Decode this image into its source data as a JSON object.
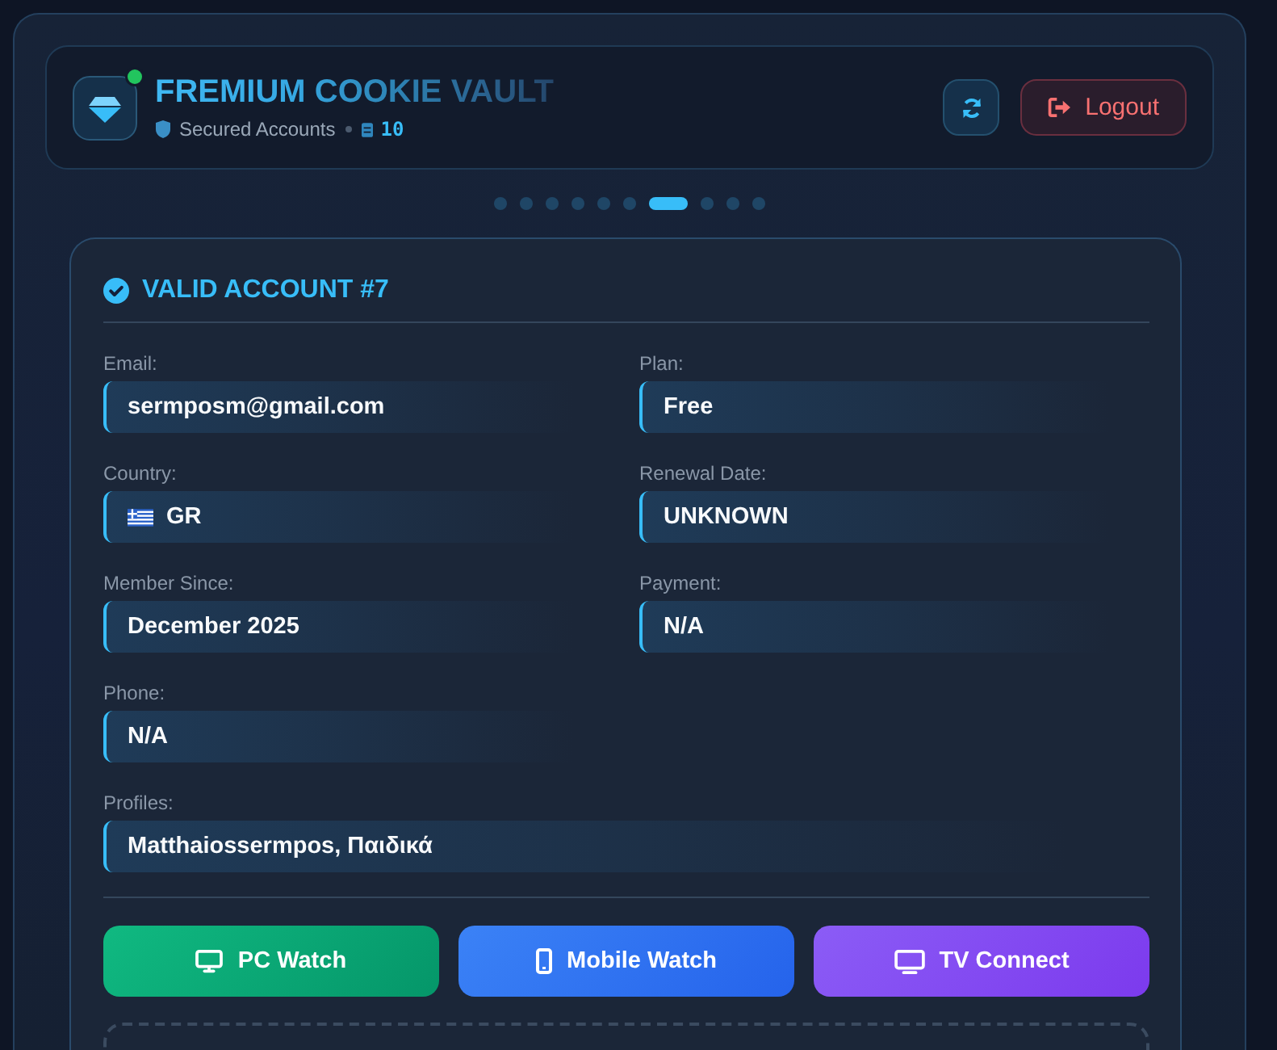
{
  "header": {
    "title": "FREMIUM COOKIE VAULT",
    "online": true,
    "subtitle": "Secured Accounts",
    "count": "10",
    "logout_label": "Logout"
  },
  "pager": [
    {
      "selected": false
    },
    {
      "selected": false
    },
    {
      "selected": false
    },
    {
      "selected": false
    },
    {
      "selected": false
    },
    {
      "selected": false
    },
    {
      "selected": true
    },
    {
      "selected": false
    },
    {
      "selected": false
    },
    {
      "selected": false
    }
  ],
  "account": {
    "title": "VALID ACCOUNT #7",
    "fields": [
      {
        "kind": "text",
        "label": "Email:",
        "value": "sermposm@gmail.com"
      },
      {
        "kind": "text",
        "label": "Plan:",
        "value": "Free"
      },
      {
        "kind": "country",
        "label": "Country:",
        "value": "GR"
      },
      {
        "kind": "text",
        "label": "Renewal Date:",
        "value": "UNKNOWN"
      },
      {
        "kind": "text",
        "label": "Member Since:",
        "value": "December 2025"
      },
      {
        "kind": "text",
        "label": "Payment:",
        "value": "N/A"
      },
      {
        "kind": "text",
        "label": "Phone:",
        "value": "N/A"
      }
    ],
    "profiles": {
      "label": "Profiles:",
      "value": "Matthaiossermpos, Παιδικά"
    },
    "actions": [
      {
        "kind": "pc",
        "label": "PC Watch"
      },
      {
        "kind": "mobile",
        "label": "Mobile Watch"
      },
      {
        "kind": "tv",
        "label": "TV Connect"
      }
    ]
  }
}
